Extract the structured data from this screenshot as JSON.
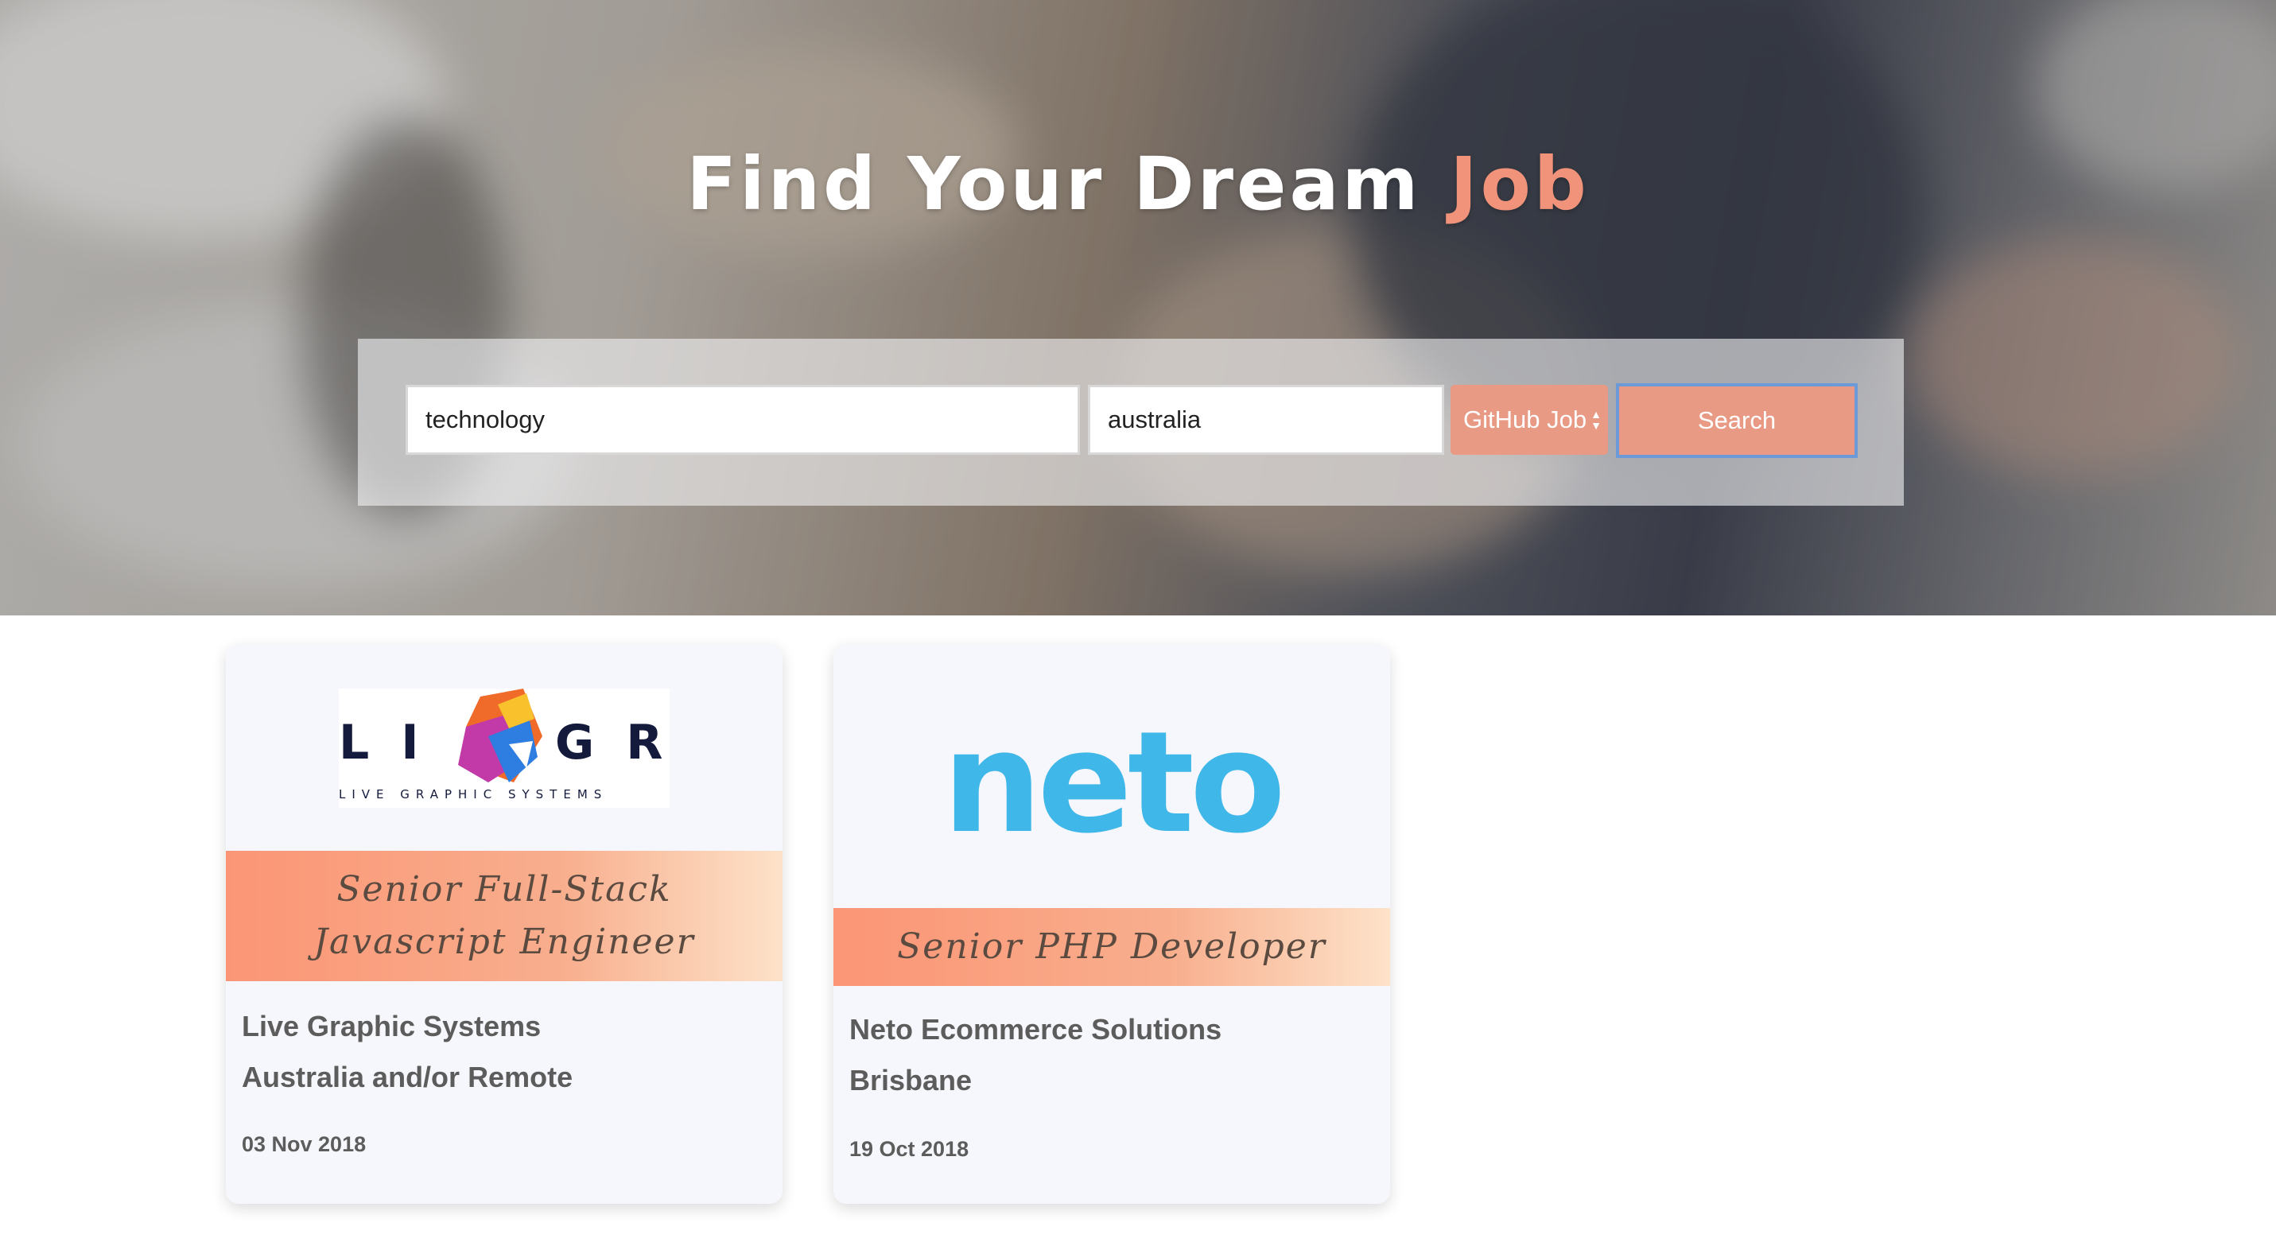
{
  "hero": {
    "title_main": "Find Your Dream ",
    "title_accent": "Job",
    "accent_color": "#f0937a"
  },
  "search": {
    "keyword_value": "technology",
    "location_value": "australia",
    "source_selected": "GitHub Job",
    "button_label": "Search",
    "button_color": "#e89a84"
  },
  "jobs": [
    {
      "logo_icon": "ligr-logo",
      "logo_text_left": "LI",
      "logo_text_right": "GR",
      "logo_tagline": "LIVE GRAPHIC SYSTEMS",
      "title_line1": "Senior Full-Stack",
      "title_line2": "Javascript Engineer",
      "company": "Live Graphic Systems",
      "location": "Australia and/or Remote",
      "date": "03 Nov 2018"
    },
    {
      "logo_icon": "neto-logo",
      "logo_text": "neto",
      "title_line1": "Senior PHP Developer",
      "company": "Neto Ecommerce Solutions",
      "location": "Brisbane",
      "date": "19 Oct 2018"
    }
  ]
}
